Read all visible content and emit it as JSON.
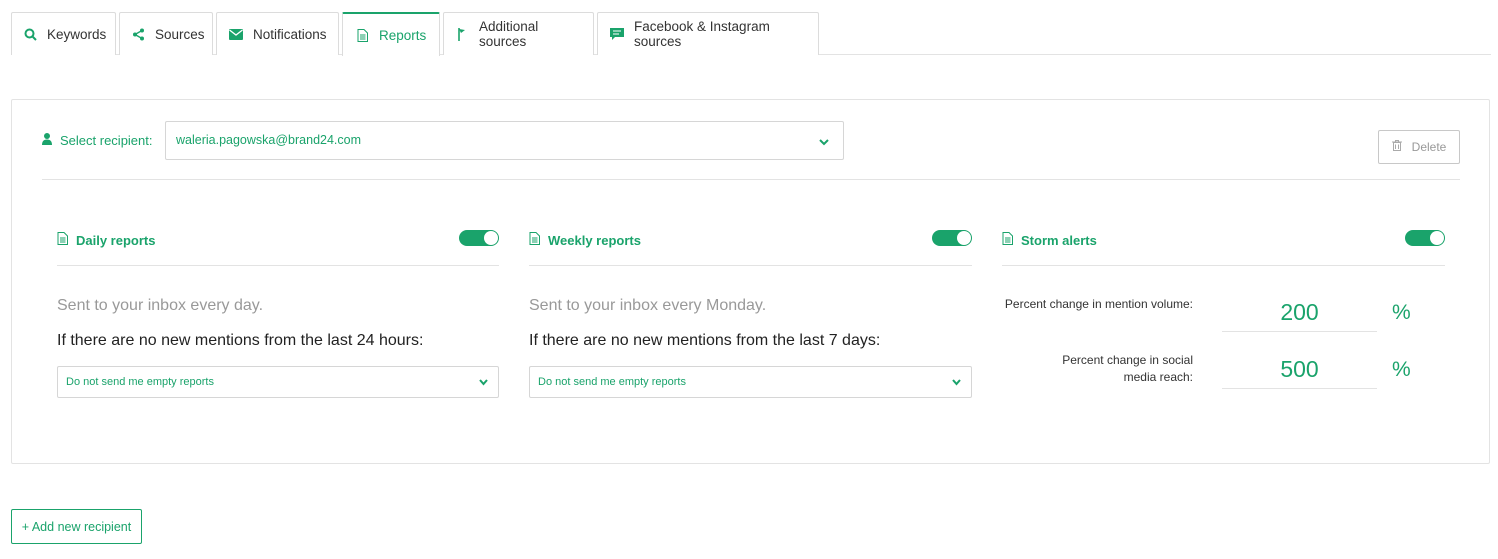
{
  "tabs": [
    {
      "label": "Keywords",
      "icon": "search-icon",
      "active": false
    },
    {
      "label": "Sources",
      "icon": "share-icon",
      "active": false
    },
    {
      "label": "Notifications",
      "icon": "envelope-icon",
      "active": false
    },
    {
      "label": "Reports",
      "icon": "document-icon",
      "active": true
    },
    {
      "label": "Additional sources",
      "icon": "flag-icon",
      "active": false
    },
    {
      "label": "Facebook & Instagram sources",
      "icon": "comment-icon",
      "active": false
    }
  ],
  "recipient": {
    "label": "Select recipient:",
    "value": "waleria.pagowska@brand24.com",
    "delete_label": "Delete"
  },
  "daily": {
    "title": "Daily reports",
    "enabled": true,
    "sent_text": "Sent to your inbox every day.",
    "empty_label": "If there are no new mentions from the last 24 hours:",
    "empty_option": "Do not send me empty reports"
  },
  "weekly": {
    "title": "Weekly reports",
    "enabled": true,
    "sent_text": "Sent to your inbox every Monday.",
    "empty_label": "If there are no new mentions from the last 7 days:",
    "empty_option": "Do not send me empty reports"
  },
  "storm": {
    "title": "Storm alerts",
    "enabled": true,
    "volume_label": "Percent change in mention volume:",
    "volume_value": "200",
    "reach_label": "Percent change in social media reach:",
    "reach_value": "500",
    "unit": "%"
  },
  "add_recipient_label": "+ Add new recipient",
  "colors": {
    "accent": "#1aa36b",
    "border": "#e3e3e3",
    "muted": "#999999"
  }
}
